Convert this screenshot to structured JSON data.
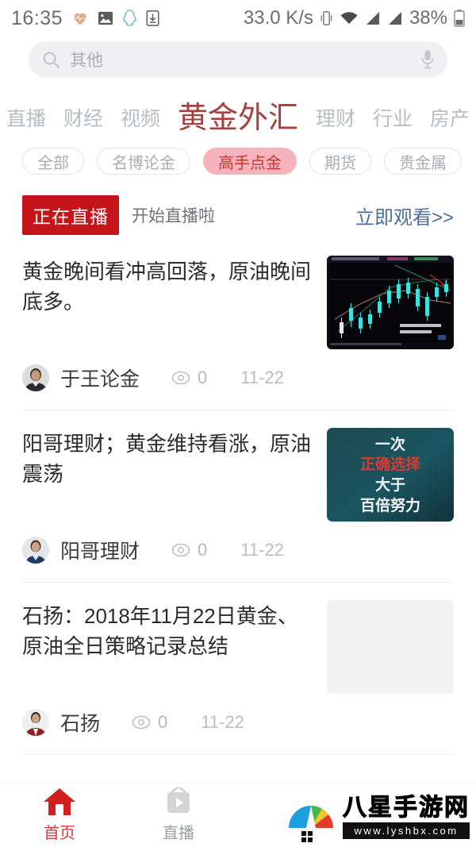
{
  "statusbar": {
    "time": "16:35",
    "left_icons": [
      "heart-rate-icon",
      "photo-icon",
      "qq-penguin-icon",
      "download-icon"
    ],
    "net_speed": "33.0 K/s",
    "right_icons": [
      "vibrate-icon",
      "wifi-icon",
      "signal-icon",
      "signal-icon"
    ],
    "battery_percent": "38%"
  },
  "search": {
    "placeholder": "其他",
    "value": "其他",
    "search_icon": "search-icon",
    "mic_icon": "microphone-icon"
  },
  "tabs": [
    {
      "label": "直播",
      "active": false
    },
    {
      "label": "财经",
      "active": false
    },
    {
      "label": "视频",
      "active": false
    },
    {
      "label": "黄金外汇",
      "active": true
    },
    {
      "label": "理财",
      "active": false
    },
    {
      "label": "行业",
      "active": false
    },
    {
      "label": "房产",
      "active": false
    }
  ],
  "chips": [
    {
      "label": "全部",
      "active": false
    },
    {
      "label": "名博论金",
      "active": false
    },
    {
      "label": "高手点金",
      "active": true
    },
    {
      "label": "期货",
      "active": false
    },
    {
      "label": "贵金属",
      "active": false
    }
  ],
  "live_banner": {
    "badge": "正在直播",
    "text": "开始直播啦",
    "link": "立即观看>>"
  },
  "feed": [
    {
      "title": "黄金晚间看冲高回落，原油晚间底多。",
      "author": "于王论金",
      "views": "0",
      "date": "11-22",
      "thumb_type": "candlestick-chart"
    },
    {
      "title": "阳哥理财；黄金维持看涨，原油震荡",
      "author": "阳哥理财",
      "views": "0",
      "date": "11-22",
      "thumb_type": "poster",
      "thumb_lines": [
        "一次",
        "正确选择",
        "大于",
        "百倍努力"
      ]
    },
    {
      "title": "石扬：2018年11月22日黄金、原油全日策略记录总结",
      "author": "石扬",
      "views": "0",
      "date": "11-22",
      "thumb_type": "placeholder"
    }
  ],
  "bottom_nav": [
    {
      "label": "首页",
      "icon": "home-icon",
      "active": true
    },
    {
      "label": "直播",
      "icon": "live-tv-icon",
      "active": false
    }
  ],
  "watermark": {
    "title": "八星手游网",
    "url": "www.lyshbx.com"
  },
  "colors": {
    "accent_red": "#a83f3f",
    "live_red": "#c5151b",
    "chip_active_bg": "#f6b3bb",
    "chip_active_text": "#c0392f",
    "link_blue": "#4c6f9c",
    "nav_active": "#d03a3a",
    "muted_text": "#b9bcc2"
  }
}
